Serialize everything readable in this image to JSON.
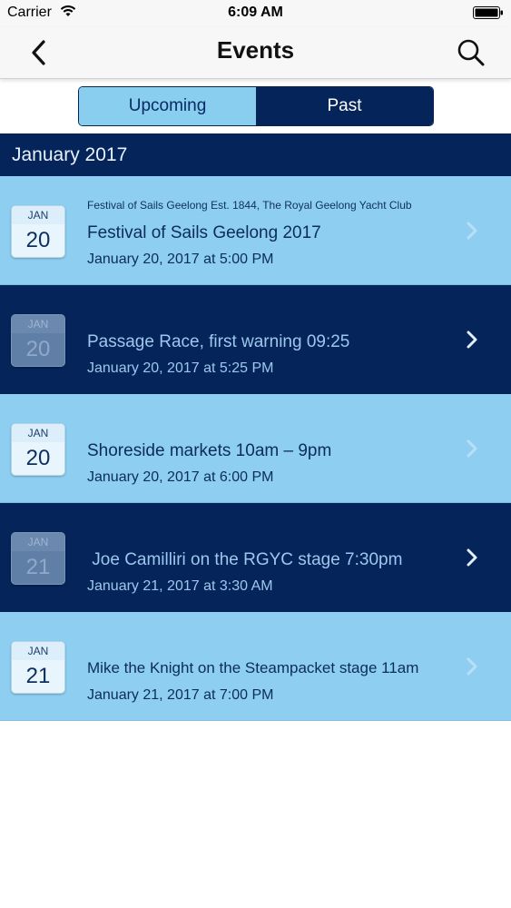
{
  "status_bar": {
    "carrier": "Carrier",
    "time": "6:09 AM"
  },
  "nav": {
    "title": "Events"
  },
  "segments": {
    "upcoming": "Upcoming",
    "past": "Past",
    "selected": "Past"
  },
  "section": {
    "title": "January 2017"
  },
  "events": [
    {
      "month": "JAN",
      "day": "20",
      "org": "Festival of Sails Geelong Est. 1844, The Royal Geelong Yacht Club",
      "title": "Festival of Sails Geelong 2017",
      "date": "January 20, 2017 at 5:00 PM"
    },
    {
      "month": "JAN",
      "day": "20",
      "org": "",
      "title": "Passage Race, first warning 09:25",
      "date": "January 20, 2017 at 5:25 PM"
    },
    {
      "month": "JAN",
      "day": "20",
      "org": "",
      "title": "Shoreside markets 10am – 9pm",
      "date": "January 20, 2017 at 6:00 PM"
    },
    {
      "month": "JAN",
      "day": "21",
      "org": "",
      "title": " Joe Camilliri on the RGYC stage 7:30pm",
      "date": "January 21, 2017 at 3:30 AM"
    },
    {
      "month": "JAN",
      "day": "21",
      "org": "",
      "title": "Mike the Knight on the Steampacket stage 11am",
      "date": "January 21, 2017 at 7:00 PM"
    }
  ],
  "colors": {
    "navy": "#05245a",
    "light_blue": "#8ecff1",
    "white": "#ffffff"
  }
}
